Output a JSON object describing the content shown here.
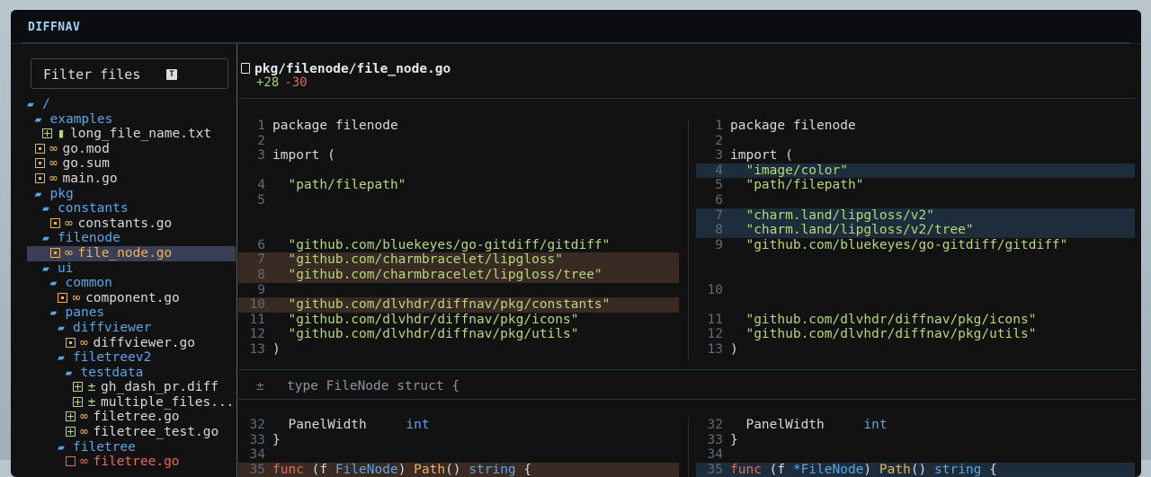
{
  "app": {
    "title": "DIFFNAV"
  },
  "filter": {
    "placeholder": "Filter files",
    "key": "T"
  },
  "tree": [
    {
      "label": "/",
      "type": "dir",
      "depth": 0
    },
    {
      "label": "examples",
      "type": "dir",
      "depth": 1
    },
    {
      "label": "long_file_name.txt",
      "type": "file",
      "status": "added",
      "glyph": "txt",
      "depth": 2
    },
    {
      "label": "go.mod",
      "type": "file",
      "status": "modified",
      "glyph": "go",
      "depth": 1
    },
    {
      "label": "go.sum",
      "type": "file",
      "status": "modified",
      "glyph": "go",
      "depth": 1
    },
    {
      "label": "main.go",
      "type": "file",
      "status": "modified",
      "glyph": "go",
      "depth": 1
    },
    {
      "label": "pkg",
      "type": "dir",
      "depth": 1
    },
    {
      "label": "constants",
      "type": "dir",
      "depth": 2
    },
    {
      "label": "constants.go",
      "type": "file",
      "status": "modified",
      "glyph": "go",
      "depth": 3
    },
    {
      "label": "filenode",
      "type": "dir",
      "depth": 2
    },
    {
      "label": "file_node.go",
      "type": "file",
      "status": "modified",
      "glyph": "go",
      "depth": 3,
      "selected": true
    },
    {
      "label": "ui",
      "type": "dir",
      "depth": 2
    },
    {
      "label": "common",
      "type": "dir",
      "depth": 3
    },
    {
      "label": "component.go",
      "type": "file",
      "status": "modified",
      "glyph": "go",
      "depth": 4
    },
    {
      "label": "panes",
      "type": "dir",
      "depth": 3
    },
    {
      "label": "diffviewer",
      "type": "dir",
      "depth": 4
    },
    {
      "label": "diffviewer.go",
      "type": "file",
      "status": "modified",
      "glyph": "go",
      "depth": 5
    },
    {
      "label": "filetreev2",
      "type": "dir",
      "depth": 4
    },
    {
      "label": "testdata",
      "type": "dir",
      "depth": 5
    },
    {
      "label": "gh_dash_pr.diff",
      "type": "file",
      "status": "added",
      "glyph": "diff",
      "depth": 6
    },
    {
      "label": "multiple_files...",
      "type": "file",
      "status": "added",
      "glyph": "diff",
      "depth": 6
    },
    {
      "label": "filetree.go",
      "type": "file",
      "status": "added",
      "glyph": "go",
      "depth": 5
    },
    {
      "label": "filetree_test.go",
      "type": "file",
      "status": "added",
      "glyph": "go",
      "depth": 5
    },
    {
      "label": "filetree",
      "type": "dir",
      "depth": 4
    },
    {
      "label": "filetree.go",
      "type": "file",
      "status": "deleted",
      "glyph": "go",
      "depth": 5
    }
  ],
  "file": {
    "path": "pkg/filenode/file_node.go",
    "additions": "+28",
    "deletions": "-30"
  },
  "hunk1": {
    "left": [
      {
        "n": "1",
        "code": "package filenode",
        "kind": "ctx"
      },
      {
        "n": "2",
        "code": "",
        "kind": "ctx"
      },
      {
        "n": "3",
        "code": "import (",
        "kind": "ctx"
      },
      {
        "n": "",
        "code": "",
        "kind": "pad"
      },
      {
        "n": "4",
        "code": "  \"path/filepath\"",
        "kind": "ctx",
        "str": true
      },
      {
        "n": "5",
        "code": "",
        "kind": "ctx"
      },
      {
        "n": "",
        "code": "",
        "kind": "pad"
      },
      {
        "n": "",
        "code": "",
        "kind": "pad"
      },
      {
        "n": "6",
        "code": "  \"github.com/bluekeyes/go-gitdiff/gitdiff\"",
        "kind": "ctx",
        "str": true
      },
      {
        "n": "7",
        "code": "  \"github.com/charmbracelet/lipgloss\"",
        "kind": "del",
        "str": true
      },
      {
        "n": "8",
        "code": "  \"github.com/charmbracelet/lipgloss/tree\"",
        "kind": "del",
        "str": true
      },
      {
        "n": "9",
        "code": "",
        "kind": "ctx"
      },
      {
        "n": "10",
        "code": "  \"github.com/dlvhdr/diffnav/pkg/constants\"",
        "kind": "del",
        "str": true
      },
      {
        "n": "11",
        "code": "  \"github.com/dlvhdr/diffnav/pkg/icons\"",
        "kind": "ctx",
        "str": true
      },
      {
        "n": "12",
        "code": "  \"github.com/dlvhdr/diffnav/pkg/utils\"",
        "kind": "ctx",
        "str": true
      },
      {
        "n": "13",
        "code": ")",
        "kind": "ctx"
      }
    ],
    "right": [
      {
        "n": "1",
        "code": "package filenode",
        "kind": "ctx"
      },
      {
        "n": "2",
        "code": "",
        "kind": "ctx"
      },
      {
        "n": "3",
        "code": "import (",
        "kind": "ctx"
      },
      {
        "n": "4",
        "code": "  \"image/color\"",
        "kind": "add",
        "str": true
      },
      {
        "n": "5",
        "code": "  \"path/filepath\"",
        "kind": "ctx",
        "str": true
      },
      {
        "n": "6",
        "code": "",
        "kind": "ctx"
      },
      {
        "n": "7",
        "code": "  \"charm.land/lipgloss/v2\"",
        "kind": "add",
        "str": true
      },
      {
        "n": "8",
        "code": "  \"charm.land/lipgloss/v2/tree\"",
        "kind": "add",
        "str": true
      },
      {
        "n": "9",
        "code": "  \"github.com/bluekeyes/go-gitdiff/gitdiff\"",
        "kind": "ctx",
        "str": true
      },
      {
        "n": "",
        "code": "",
        "kind": "pad"
      },
      {
        "n": "",
        "code": "",
        "kind": "pad"
      },
      {
        "n": "10",
        "code": "",
        "kind": "ctx"
      },
      {
        "n": "",
        "code": "",
        "kind": "pad"
      },
      {
        "n": "11",
        "code": "  \"github.com/dlvhdr/diffnav/pkg/icons\"",
        "kind": "ctx",
        "str": true
      },
      {
        "n": "12",
        "code": "  \"github.com/dlvhdr/diffnav/pkg/utils\"",
        "kind": "ctx",
        "str": true
      },
      {
        "n": "13",
        "code": ")",
        "kind": "ctx"
      }
    ]
  },
  "hunk_header": {
    "icon": "±",
    "text": "type FileNode struct {"
  },
  "hunk2": {
    "left": [
      {
        "n": "32",
        "code": "  PanelWidth     int",
        "kind": "ctx"
      },
      {
        "n": "33",
        "code": "}",
        "kind": "ctx"
      },
      {
        "n": "34",
        "code": "",
        "kind": "ctx"
      },
      {
        "n": "35",
        "code": "func (f FileNode) Path() string {",
        "kind": "del"
      }
    ],
    "right": [
      {
        "n": "32",
        "code": "  PanelWidth     int",
        "kind": "ctx"
      },
      {
        "n": "33",
        "code": "}",
        "kind": "ctx"
      },
      {
        "n": "34",
        "code": "",
        "kind": "ctx"
      },
      {
        "n": "35",
        "code": "func (f *FileNode) Path() string {",
        "kind": "add"
      }
    ]
  },
  "colors": {
    "accent": "#58a6e8",
    "added": "#b8d67a",
    "modified": "#e9b35a",
    "deleted": "#e56a5a"
  }
}
